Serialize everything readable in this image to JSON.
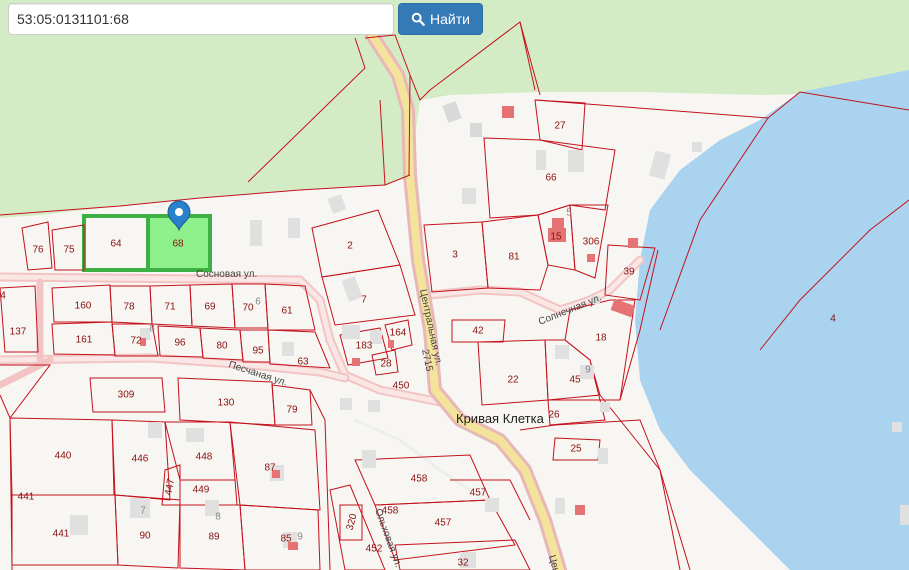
{
  "search": {
    "value": "53:05:0131101:68",
    "button_label": "Найти",
    "icon": "search-icon"
  },
  "map": {
    "place_name": "Кривая Клетка",
    "streets": {
      "sosnovaya": "Сосновая ул.",
      "peschanaya": "Песчаная ул.",
      "centralnaya": "Центральная ул.",
      "solnechnaya": "Солнечная ул.",
      "road_number": "2715",
      "bottom_left": "Ольховая ул.",
      "bottom_right": "Цен"
    },
    "selected_parcel": "68",
    "marker_icon": "map-pin-icon",
    "parcel_labels": {
      "p76": "76",
      "p75": "75",
      "p64": "64",
      "p68": "68",
      "p2": "2",
      "p7": "7",
      "p3": "3",
      "p81": "81",
      "p15": "15",
      "p306": "306",
      "p5": "5",
      "p27": "27",
      "p66": "66",
      "p39": "39",
      "p4": "4",
      "p42": "42",
      "p18": "18",
      "p22": "22",
      "p45": "45",
      "p9a": "9",
      "p26": "26",
      "p25": "25",
      "p160": "160",
      "p78": "78",
      "p71": "71",
      "p69": "69",
      "p70": "70",
      "p6": "6",
      "p61": "61",
      "p137": "137",
      "p161": "161",
      "p72": "72",
      "p8a": "8",
      "p96": "96",
      "p80": "80",
      "p95": "95",
      "p63": "63",
      "p183": "183",
      "p164": "164",
      "p28": "28",
      "p450": "450",
      "p309": "309",
      "p130": "130",
      "p79": "79",
      "p440": "440",
      "p446": "446",
      "p448": "448",
      "p87": "87",
      "p447": "447",
      "p449": "449",
      "p441a": "441",
      "p441b": "441",
      "p7b": "7",
      "p90": "90",
      "p8b": "8",
      "p89": "89",
      "p85": "85",
      "p9b": "9",
      "p458a": "458",
      "p457a": "457",
      "p458b": "458",
      "p457b": "457",
      "p320": "320",
      "p452": "452",
      "p32": "32",
      "p4l": "4"
    },
    "colors": {
      "forest": "#d4ecc6",
      "water": "#aad3f0",
      "parcel_border": "#c4111c",
      "selected_fill": "#8ef08a",
      "selected_border": "#3cb043",
      "road_fill": "#f7d7d7",
      "main_road": "#f4e39a",
      "building": "#d9d9d9",
      "building_red": "#e57373",
      "marker": "#2a81cb"
    }
  }
}
